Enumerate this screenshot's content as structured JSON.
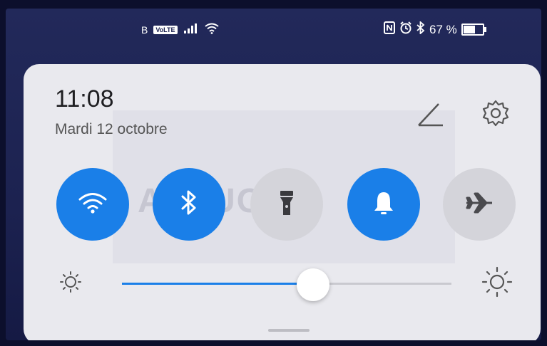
{
  "statusbar": {
    "carrier": "B",
    "volte_label": "VoLTE",
    "battery": "67 %",
    "battery_level": 0.67
  },
  "panel": {
    "time": "11:08",
    "date": "Mardi 12 octobre",
    "watermark": "ASTUCES"
  },
  "tiles": [
    {
      "name": "wifi",
      "icon": "wifi-icon",
      "state": "on"
    },
    {
      "name": "bluetooth",
      "icon": "bluetooth-icon",
      "state": "on"
    },
    {
      "name": "flashlight",
      "icon": "flashlight-icon",
      "state": "off"
    },
    {
      "name": "sound",
      "icon": "bell-icon",
      "state": "on"
    },
    {
      "name": "airplane-mode",
      "icon": "airplane-icon",
      "state": "off"
    }
  ],
  "brightness": {
    "level": 0.58
  },
  "colors": {
    "accent": "#1a7fe8",
    "panel": "#e9e9ee",
    "inactive_tile": "#d4d4da"
  }
}
